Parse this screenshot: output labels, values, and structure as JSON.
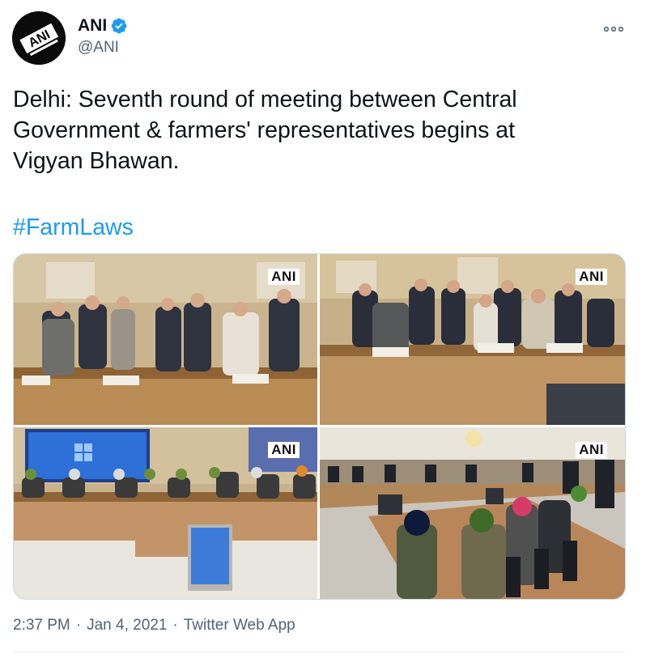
{
  "author": {
    "name": "ANI",
    "handle": "@ANI",
    "avatar_text": "ANI",
    "verified_icon": "verified-badge"
  },
  "tweet": {
    "text": "Delhi: Seventh round of meeting between Central\nGovernment & farmers' representatives begins at\nVigyan Bhawan.",
    "hashtag": "#FarmLaws"
  },
  "media": {
    "photos": [
      {
        "watermark": "ANI"
      },
      {
        "watermark": "ANI"
      },
      {
        "watermark": "ANI"
      },
      {
        "watermark": "ANI"
      }
    ]
  },
  "meta": {
    "time": "2:37 PM",
    "separator": "·",
    "date": "Jan 4, 2021",
    "source": "Twitter Web App"
  },
  "colors": {
    "link": "#1d9bf0",
    "secondary_text": "#536471",
    "verified": "#1d9bf0"
  },
  "icons": [
    "more-icon",
    "verified-badge"
  ]
}
